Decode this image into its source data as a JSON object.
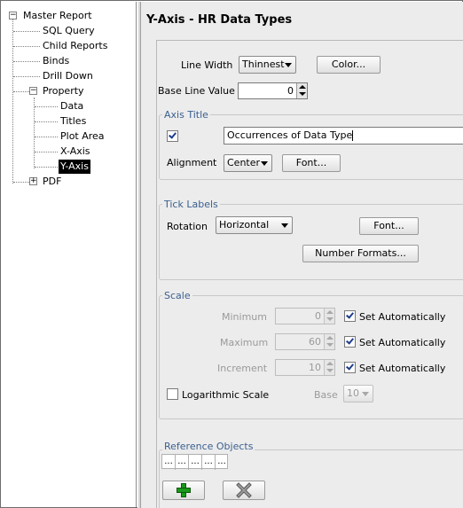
{
  "tree": {
    "root": "Master Report",
    "items": [
      "SQL Query",
      "Child Reports",
      "Binds",
      "Drill Down"
    ],
    "property": "Property",
    "property_items": [
      "Data",
      "Titles",
      "Plot Area",
      "X-Axis"
    ],
    "selected": "Y-Axis",
    "pdf": "PDF"
  },
  "panel": {
    "title": "Y-Axis - HR Data Types",
    "line_width_label": "Line Width",
    "line_width_value": "Thinnest",
    "color_button": "Color...",
    "base_line_label": "Base Line Value",
    "base_line_value": "0"
  },
  "axis_title": {
    "group_label": "Axis Title",
    "enabled": true,
    "text": "Occurrences of Data Type",
    "alignment_label": "Alignment",
    "alignment_value": "Center",
    "font_button": "Font..."
  },
  "tick_labels": {
    "group_label": "Tick Labels",
    "rotation_label": "Rotation",
    "rotation_value": "Horizontal",
    "font_button": "Font...",
    "number_formats_button": "Number Formats..."
  },
  "scale": {
    "group_label": "Scale",
    "minimum_label": "Minimum",
    "minimum_value": "0",
    "maximum_label": "Maximum",
    "maximum_value": "60",
    "increment_label": "Increment",
    "increment_value": "10",
    "set_auto_label": "Set Automatically",
    "log_label": "Logarithmic Scale",
    "base_label": "Base",
    "base_value": "10"
  },
  "reference_objects": {
    "group_label": "Reference Objects",
    "cells": [
      "...",
      "...",
      "...",
      "...",
      "..."
    ],
    "add_icon": "plus-icon",
    "delete_icon": "x-icon",
    "add_color": "#1a9a1a"
  }
}
